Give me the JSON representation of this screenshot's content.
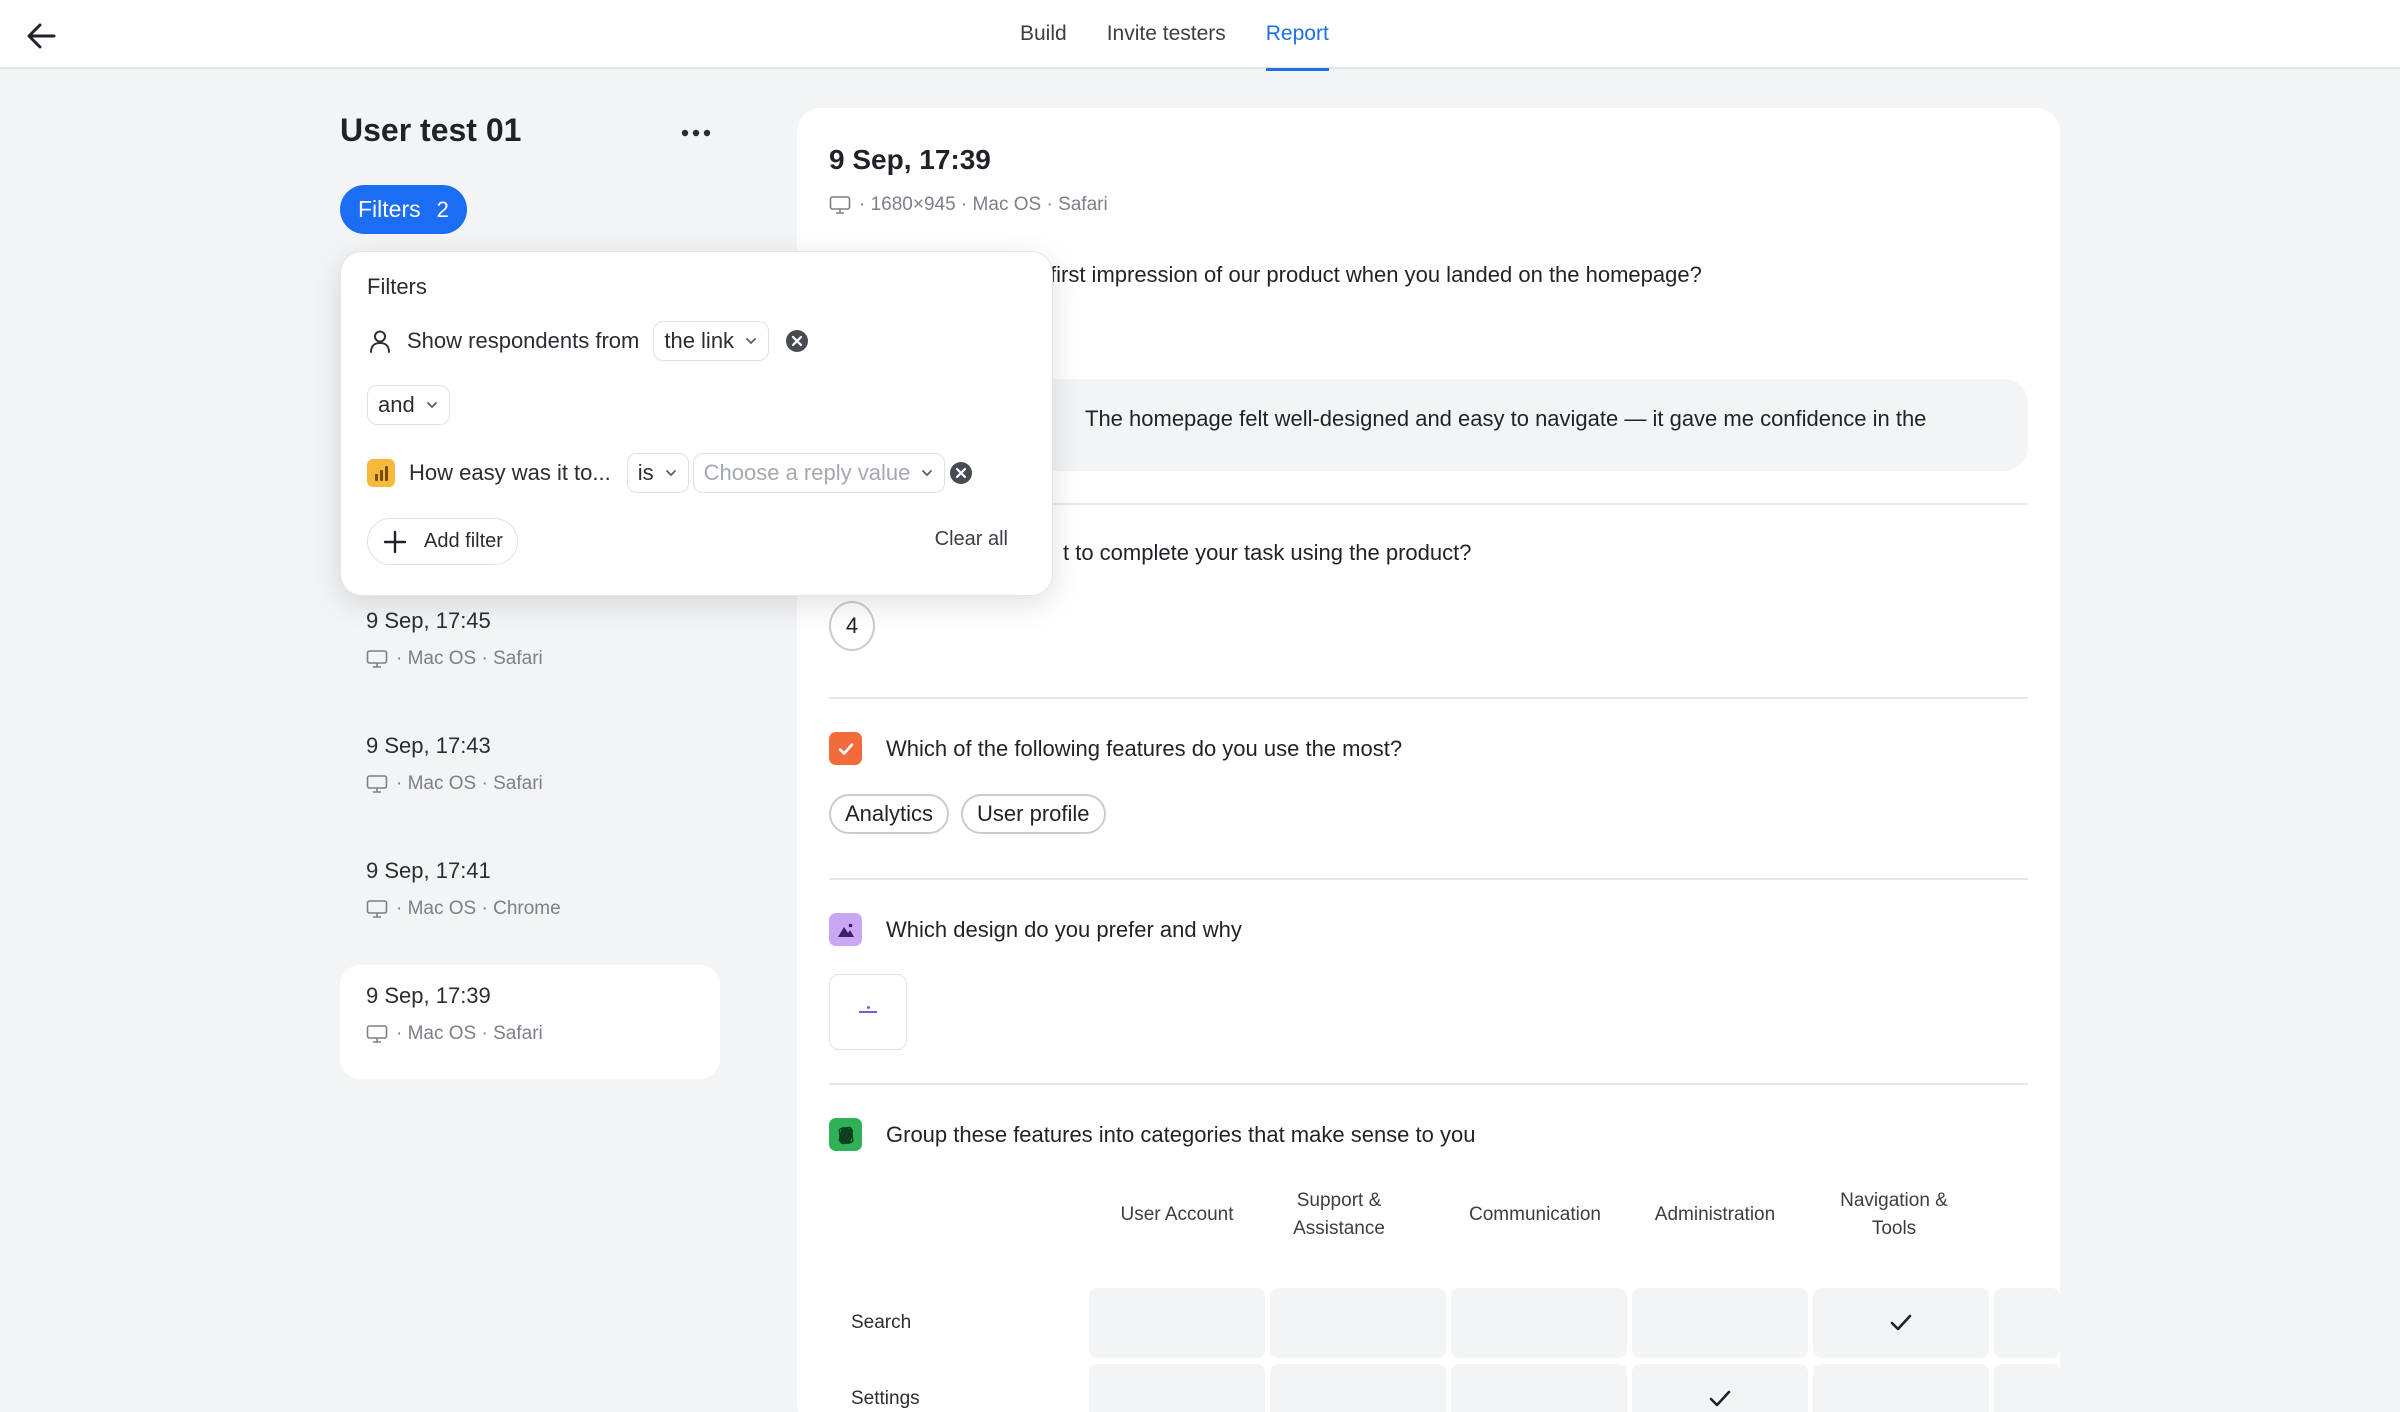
{
  "topbar": {
    "back_icon": "arrow-left-icon",
    "tabs": [
      {
        "label": "Build",
        "active": false
      },
      {
        "label": "Invite testers",
        "active": false
      },
      {
        "label": "Report",
        "active": true
      }
    ],
    "accent_color": "#1f6fe8"
  },
  "sidebar": {
    "title": "User test 01",
    "filters_button": {
      "label": "Filters",
      "count": "2"
    },
    "sessions": [
      {
        "when": "9 Sep, 17:45",
        "meta": "· Mac OS · Safari",
        "selected": false
      },
      {
        "when": "9 Sep, 17:43",
        "meta": "· Mac OS · Safari",
        "selected": false
      },
      {
        "when": "9 Sep, 17:41",
        "meta": "· Mac OS · Chrome",
        "selected": false
      },
      {
        "when": "9 Sep, 17:39",
        "meta": "· Mac OS · Safari",
        "selected": true
      }
    ]
  },
  "filter_popup": {
    "title": "Filters",
    "row1": {
      "label": "Show respondents from",
      "value": "the link"
    },
    "conjunction": "and",
    "row2": {
      "label": "How easy was it to...",
      "operator": "is",
      "value_placeholder": "Choose a reply value"
    },
    "add_filter_label": "Add filter",
    "clear_all_label": "Clear all"
  },
  "response": {
    "date": "9 Sep, 17:39",
    "meta": "· 1680×945 · Mac OS · Safari",
    "q1": {
      "text": "first impression of our product when you landed on the homepage?",
      "answer": "The homepage felt well-designed and easy to navigate — it gave me confidence in the"
    },
    "q2": {
      "text": "t to complete your task using the product?",
      "rating": "4"
    },
    "q3": {
      "text": "Which of the following features do you use the most?",
      "choices": [
        "Analytics",
        "User profile"
      ],
      "icon_color": "#f26b3a"
    },
    "q4": {
      "text": "Which design do you prefer and why",
      "icon_color": "#c9a7f5"
    },
    "q5": {
      "text": "Group these features into categories that make sense to you",
      "icon_color": "#2fb157",
      "columns": [
        "User Account",
        "Support & Assistance",
        "Communication",
        "Administration",
        "Navigation & Tools"
      ],
      "rows": [
        {
          "label": "Search",
          "checked_column": 4
        },
        {
          "label": "Settings",
          "checked_column": 3
        }
      ]
    }
  }
}
